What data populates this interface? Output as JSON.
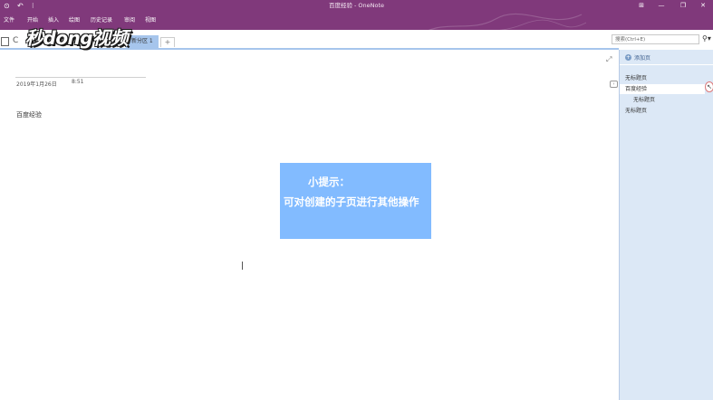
{
  "window": {
    "title": "百度经验 - OneNote",
    "quick_access": [
      "⊙",
      "↶",
      "⁝"
    ],
    "controls": [
      "⊞",
      "—",
      "❐",
      "✕"
    ]
  },
  "ribbon": {
    "tabs": [
      "文件",
      "开始",
      "插入",
      "绘图",
      "历史记录",
      "审阅",
      "视图"
    ]
  },
  "notebook": {
    "name": "C",
    "watermark_logo": "秒dong视频",
    "section_tab": "新分区 1",
    "add_section": "+"
  },
  "search": {
    "placeholder": "搜索(Ctrl+E)",
    "icon": "search-icon"
  },
  "page": {
    "date": "2019年1月26日",
    "time": "8:51",
    "body_text": "百度经验"
  },
  "tip": {
    "title": "小提示：",
    "text": "可对创建的子页进行其他操作"
  },
  "pane": {
    "add_page_label": "添加页",
    "pages": [
      {
        "label": "无标题页",
        "level": 0,
        "selected": false
      },
      {
        "label": "百度经验",
        "level": 0,
        "selected": true
      },
      {
        "label": "无标题页",
        "level": 1,
        "selected": false
      },
      {
        "label": "无标题页",
        "level": 0,
        "selected": false
      }
    ]
  },
  "colors": {
    "accent": "#80397b",
    "section_tab": "#a6c5ec",
    "pane": "#dce8f6",
    "tip_box": "#82bbff"
  }
}
